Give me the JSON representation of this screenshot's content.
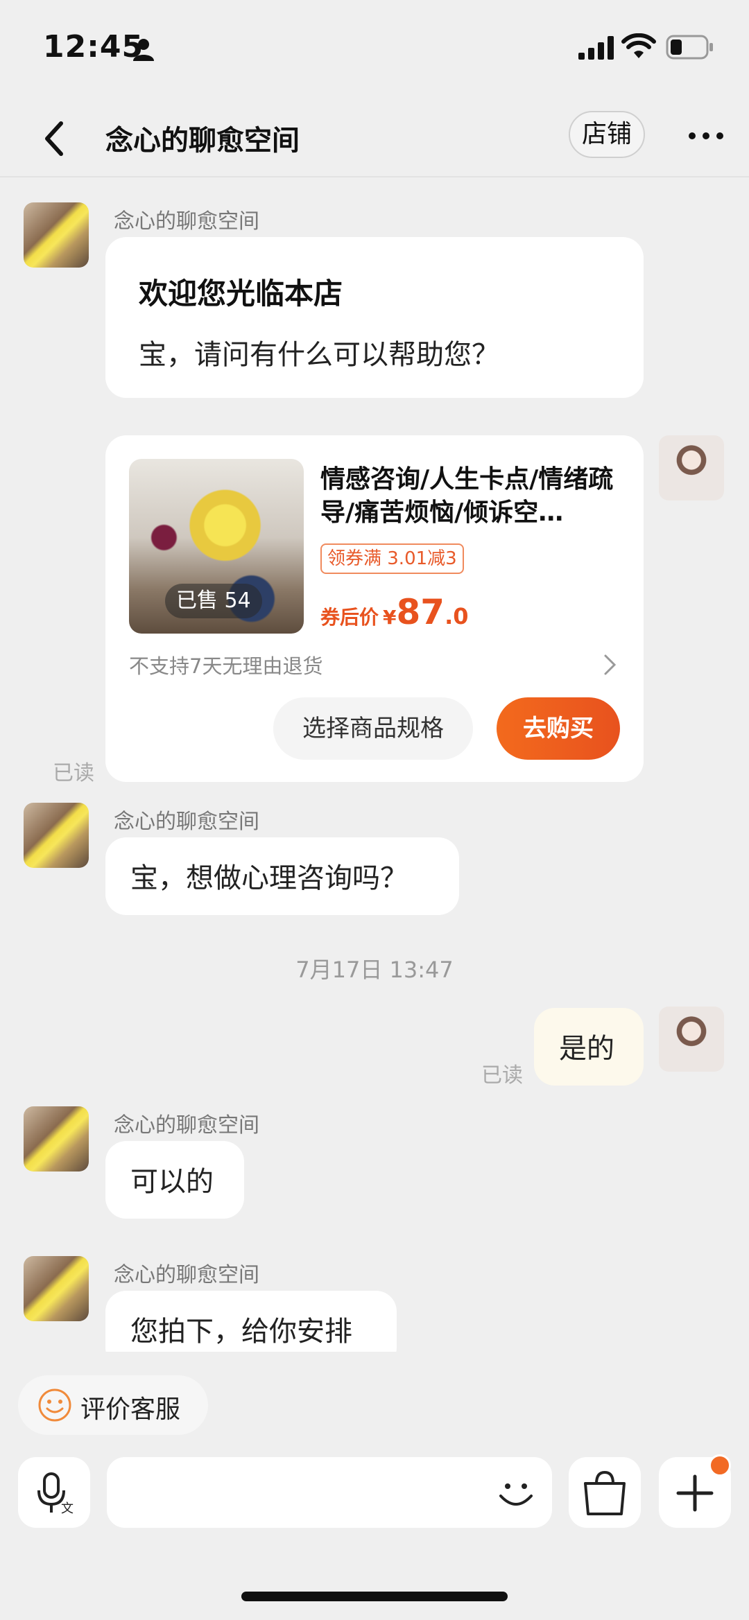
{
  "status_bar": {
    "time": "12:45"
  },
  "header": {
    "title": "念心的聊愈空间",
    "store_button": "店铺"
  },
  "messages": {
    "m1": {
      "sender": "念心的聊愈空间",
      "heading": "欢迎您光临本店",
      "text": "宝，请问有什么可以帮助您？"
    },
    "product": {
      "title": "情感咨询/人生卡点/情绪疏导/痛苦烦恼/倾诉空…",
      "sold": "已售 54",
      "coupon": "领券满 3.01减3",
      "price_label": "券后价",
      "currency": "¥",
      "price_int": "87",
      "price_dec": ".0",
      "return_policy": "不支持7天无理由退货",
      "spec_button": "选择商品规格",
      "buy_button": "去购买",
      "read": "已读"
    },
    "m2": {
      "sender": "念心的聊愈空间",
      "text": "宝，想做心理咨询吗？"
    },
    "timestamp": "7月17日 13:47",
    "m3": {
      "text": "是的",
      "read": "已读"
    },
    "m4": {
      "sender": "念心的聊愈空间",
      "text": "可以的"
    },
    "m5": {
      "sender": "念心的聊愈空间",
      "text": "您拍下，给你安排"
    }
  },
  "bottom": {
    "evaluate_button": "评价客服"
  },
  "colors": {
    "accent": "#e8521e",
    "background": "#efefef",
    "own_bubble": "#fdf9ec"
  }
}
